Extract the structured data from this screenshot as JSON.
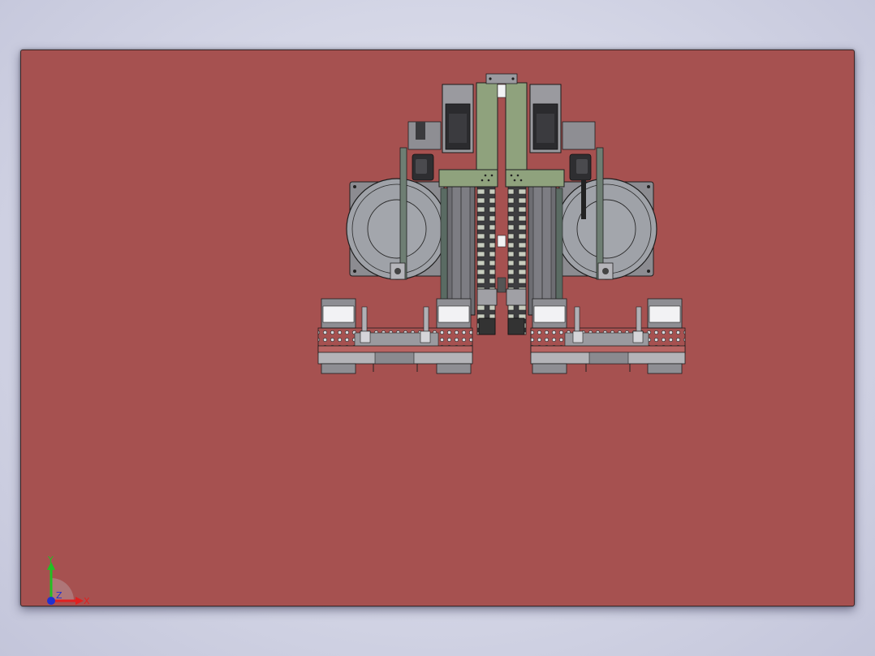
{
  "viewport": {
    "background_color": "#a65150",
    "page_background_color": "#d6d8e8"
  },
  "model": {
    "icon": "cad-assembly-drawing",
    "part_colors": {
      "frame_green": "#8fa27d",
      "steel_gray": "#9a9a9f",
      "motor_dark": "#303033",
      "rail_gray": "#6f6f74",
      "plate_red": "#b86462",
      "white_block": "#f2f2f4"
    }
  },
  "triad": {
    "x_label": "X",
    "y_label": "Y",
    "z_label": "Z",
    "x_color": "#e02020",
    "y_color": "#22c022",
    "z_color": "#2030d0"
  }
}
